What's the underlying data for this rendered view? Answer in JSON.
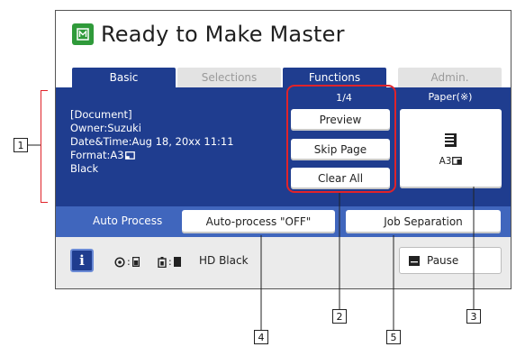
{
  "title": "Ready to Make Master",
  "tabs": [
    {
      "label": "Basic",
      "state": "active"
    },
    {
      "label": "Selections",
      "state": "inactive"
    },
    {
      "label": "Functions",
      "state": "active"
    },
    {
      "label": "Admin.",
      "state": "inactive"
    }
  ],
  "document_info": {
    "line1": "[Document]",
    "line2": "Owner:Suzuki",
    "line3": "Date&Time:Aug 18, 20xx 11:11",
    "line4": "Format:A3",
    "line5": "Black"
  },
  "page_count": "1/4",
  "buttons": {
    "preview": "Preview",
    "skip_page": "Skip Page",
    "clear_all": "Clear All"
  },
  "paper": {
    "label": "Paper(※)",
    "size": "A3"
  },
  "auto_process": {
    "label": "Auto Process",
    "toggle": "Auto-process \"OFF\"",
    "job_separation": "Job Separation"
  },
  "status": {
    "info_glyph": "i",
    "item1_separator": ":",
    "item2_separator": ":",
    "hd_text": "HD Black",
    "pause": "Pause"
  },
  "callouts": {
    "c1": "1",
    "c2": "2",
    "c3": "3",
    "c4": "4",
    "c5": "5"
  },
  "colors": {
    "band": "#1f3d8f",
    "band_light": "#4066bd",
    "title_icon": "#2f9a3a",
    "callout": "#e0232a"
  }
}
